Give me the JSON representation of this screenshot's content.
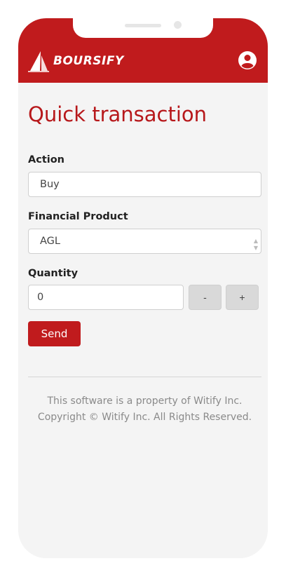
{
  "header": {
    "brand": "BOURSIFY",
    "brand_color": "#c01b1d",
    "account_icon": "account-circle-icon"
  },
  "form": {
    "title": "Quick transaction",
    "action": {
      "label": "Action",
      "value": "Buy"
    },
    "product": {
      "label": "Financial Product",
      "value": "AGL"
    },
    "quantity": {
      "label": "Quantity",
      "value": "0",
      "decrement": "-",
      "increment": "+"
    },
    "submit": "Send"
  },
  "footer": {
    "line1": "This software is a property of Witify Inc.",
    "line2": "Copyright © Witify Inc. All Rights Reserved."
  }
}
